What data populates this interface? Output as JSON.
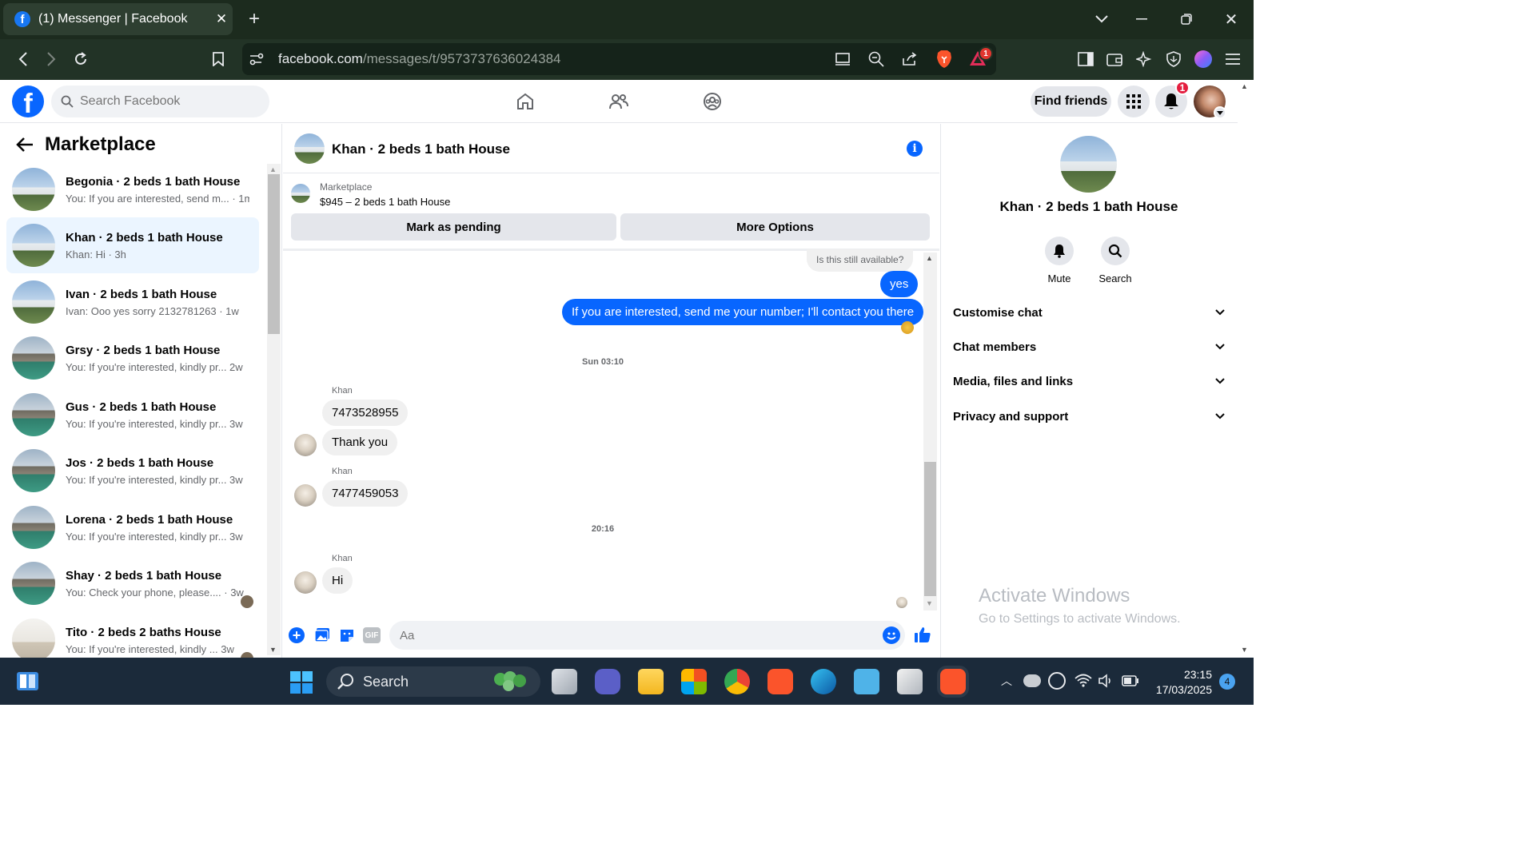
{
  "browser": {
    "tab_title": "(1) Messenger | Facebook",
    "url_host": "facebook.com",
    "url_path": "/messages/t/9573737636024384",
    "brave_badge": "1",
    "colors": {
      "tabbar": "#1c2b1e",
      "toolbar": "#223326"
    }
  },
  "fb_header": {
    "search_placeholder": "Search Facebook",
    "find_friends_label": "Find friends",
    "notification_count": "1",
    "nav_icons": [
      "home-icon",
      "friends-icon",
      "groups-icon"
    ]
  },
  "left_panel": {
    "title": "Marketplace",
    "conversations": [
      {
        "name": "Begonia · 2 beds 1 bath House",
        "preview": "You: If you are interested, send m... · 1m",
        "thumb": "house-a",
        "active": false
      },
      {
        "name": "Khan · 2 beds 1 bath House",
        "preview": "Khan: Hi · 3h",
        "thumb": "house-a",
        "active": true
      },
      {
        "name": "Ivan · 2 beds 1 bath House",
        "preview": "Ivan: Ooo yes sorry 2132781263 · 1w",
        "thumb": "house-a",
        "active": false
      },
      {
        "name": "Grsy · 2 beds 1 bath House",
        "preview": "You: If you're interested, kindly pr...    2w",
        "thumb": "house-b",
        "active": false
      },
      {
        "name": "Gus · 2 beds 1 bath House",
        "preview": "You: If you're interested, kindly pr...    3w",
        "thumb": "house-b",
        "active": false
      },
      {
        "name": "Jos · 2 beds 1 bath House",
        "preview": "You: If you're interested, kindly pr...    3w",
        "thumb": "house-b",
        "active": false
      },
      {
        "name": "Lorena · 2 beds 1 bath House",
        "preview": "You: If you're interested, kindly pr...    3w",
        "thumb": "house-b",
        "active": false
      },
      {
        "name": "Shay · 2 beds 1 bath House",
        "preview": "You: Check your phone, please.... · 3w",
        "thumb": "house-b",
        "active": false
      },
      {
        "name": "Tito · 2 beds 2 baths House",
        "preview": "You: If you're interested, kindly ...  3w",
        "thumb": "house-c",
        "active": false
      }
    ]
  },
  "chat": {
    "title": "Khan · 2 beds 1 bath House",
    "listing_source": "Marketplace",
    "listing_price": "$945 – 2 beds 1 bath House",
    "mark_pending_label": "Mark as pending",
    "more_options_label": "More Options",
    "messages": {
      "q_available": "Is this still available?",
      "out_yes": "yes",
      "out_long": "If you are interested, send me your number; I'll contact you there",
      "ts1": "Sun 03:10",
      "sender1": "Khan",
      "in1": "7473528955",
      "in2": "Thank you",
      "sender2": "Khan",
      "in3": "7477459053",
      "ts2": "20:16",
      "sender3": "Khan",
      "in4": "Hi"
    },
    "composer_placeholder": "Aa",
    "colors": {
      "outgoing": "#0866ff",
      "incoming": "#f0f0f0"
    }
  },
  "right_panel": {
    "title": "Khan · 2 beds 1 bath House",
    "mute_label": "Mute",
    "search_label": "Search",
    "sections": [
      "Customise chat",
      "Chat members",
      "Media, files and links",
      "Privacy and support"
    ]
  },
  "watermark": {
    "line1": "Activate Windows",
    "line2": "Go to Settings to activate Windows."
  },
  "taskbar": {
    "search_label": "Search",
    "time": "23:15",
    "date": "17/03/2025",
    "notification_count": "4"
  }
}
